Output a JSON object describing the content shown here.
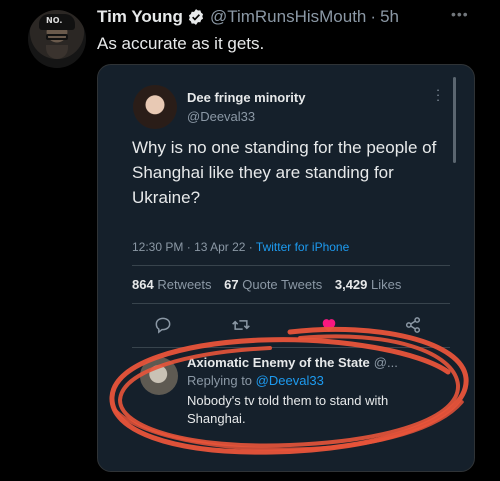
{
  "outer": {
    "name": "Tim Young",
    "handle": "@TimRunsHisMouth",
    "separator": "·",
    "time": "5h",
    "text": "As accurate as it gets.",
    "avatar_cap_text": "NO."
  },
  "screenshot": {
    "tweet": {
      "name": "Dee fringe minority",
      "handle": "@Deeval33",
      "body": "Why is no one standing for the people of Shanghai like they are standing for Ukraine?",
      "time": "12:30 PM",
      "date": "13 Apr 22",
      "source": "Twitter for iPhone",
      "stats": [
        {
          "count": "864",
          "label": "Retweets"
        },
        {
          "count": "67",
          "label": "Quote Tweets"
        },
        {
          "count": "3,429",
          "label": "Likes"
        }
      ]
    },
    "actions": [
      "reply-icon",
      "retweet-icon",
      "like-icon",
      "share-icon"
    ],
    "reply": {
      "name": "Axiomatic Enemy of the State",
      "handle": "@...",
      "replying_prefix": "Replying to",
      "replying_handle": "@Deeval33",
      "text": "Nobody's tv told them to stand with Shanghai."
    }
  },
  "colors": {
    "background": "#000000",
    "card": "#15202b",
    "accent": "#1d9bf0",
    "muted": "#8b98a5",
    "like": "#f91880",
    "annotation": "#e8543a"
  }
}
